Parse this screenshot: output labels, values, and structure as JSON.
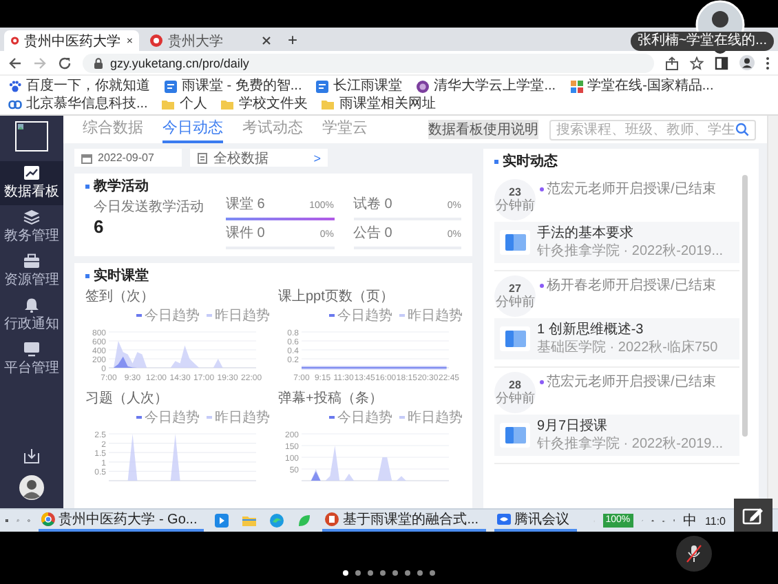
{
  "meeting": {
    "speaker_label": "张利楠~学堂在线的...",
    "pager": [
      {
        "selected": true
      },
      {
        "selected": false
      },
      {
        "selected": false
      },
      {
        "selected": false
      },
      {
        "selected": false
      },
      {
        "selected": false
      },
      {
        "selected": false
      },
      {
        "selected": false
      }
    ]
  },
  "browser": {
    "tabs": [
      {
        "title": "贵州中医药大学",
        "selected": true
      },
      {
        "title": "贵州大学",
        "selected": false
      }
    ],
    "new_tab": "+",
    "url": "gzy.yuketang.cn/pro/daily",
    "bookmarks": [
      {
        "label": "百度一下，你就知道",
        "kind": "paw"
      },
      {
        "label": "雨课堂 - 免费的智...",
        "kind": "site"
      },
      {
        "label": "长江雨课堂",
        "kind": "site"
      },
      {
        "label": "清华大学云上学堂...",
        "kind": "seal"
      },
      {
        "label": "学堂在线-国家精品...",
        "kind": "grid"
      },
      {
        "label": "北京慕华信息科技...",
        "kind": "link"
      },
      {
        "label": "个人",
        "kind": "folder"
      },
      {
        "label": "学校文件夹",
        "kind": "folder"
      },
      {
        "label": "雨课堂相关网址",
        "kind": "folder"
      }
    ]
  },
  "app": {
    "sidebar": {
      "items": [
        {
          "label": "数据看板",
          "kind": "chart",
          "selected": true
        },
        {
          "label": "教务管理",
          "kind": "layers",
          "selected": false
        },
        {
          "label": "资源管理",
          "kind": "box",
          "selected": false
        },
        {
          "label": "行政通知",
          "kind": "bell",
          "selected": false
        },
        {
          "label": "平台管理",
          "kind": "monitor",
          "selected": false
        }
      ]
    },
    "tabs": [
      {
        "label": "综合数据",
        "selected": false
      },
      {
        "label": "今日动态",
        "selected": true
      },
      {
        "label": "考试动态",
        "selected": false
      },
      {
        "label": "学堂云",
        "selected": false
      }
    ],
    "help_link": "数据看板使用说明",
    "search": {
      "placeholder": "搜索课程、班级、教师、学生"
    },
    "filters": {
      "date": "2022-09-07",
      "scope": "全校数据",
      "next": ">"
    },
    "teaching_activity": {
      "title": "教学活动",
      "summary_label": "今日发送教学活动",
      "summary_value": "6",
      "metrics": [
        {
          "label": "课堂",
          "count": "6",
          "percent": "100%",
          "level": 1
        },
        {
          "label": "试卷",
          "count": "0",
          "percent": "0%",
          "level": 0
        },
        {
          "label": "课件",
          "count": "0",
          "percent": "0%",
          "level": 0
        },
        {
          "label": "公告",
          "count": "0",
          "percent": "0%",
          "level": 0
        }
      ]
    },
    "live_class": {
      "title": "实时课堂",
      "charts": [
        {
          "title": "签到（次）",
          "chart_data": {
            "type": "area",
            "x": [
              7,
              7.5,
              8,
              8.5,
              9,
              9.5,
              10,
              10.5,
              11,
              11.5,
              12,
              12.5,
              13,
              13.5,
              14,
              14.5,
              15,
              15.5,
              16,
              16.5,
              17,
              17.5,
              18,
              18.5,
              19,
              19.5,
              20,
              20.5,
              21,
              21.5,
              22,
              22.5
            ],
            "xlim": [
              7,
              22.5
            ],
            "ylim": [
              0,
              800
            ],
            "yticks": [
              0,
              200,
              400,
              600,
              800
            ],
            "grid": true,
            "legend": "top-right",
            "xticks": [
              {
                "value": 7,
                "label": "7:00"
              },
              {
                "value": 9.5,
                "label": "9:30"
              },
              {
                "value": 12,
                "label": "12:00"
              },
              {
                "value": 14.5,
                "label": "14:30"
              },
              {
                "value": 17,
                "label": "17:00"
              },
              {
                "value": 19.5,
                "label": "19:30"
              },
              {
                "value": 22,
                "label": "22:00"
              }
            ],
            "series": [
              {
                "name": "今日趋势",
                "color": "#6a79ee",
                "values": [
                  0,
                  0,
                  80,
                  250,
                  30,
                  10,
                  0,
                  0,
                  0,
                  0,
                  0,
                  0,
                  0,
                  0,
                  0,
                  0,
                  0,
                  0,
                  0,
                  0,
                  0,
                  0,
                  0,
                  0,
                  0,
                  0,
                  0,
                  0,
                  0,
                  0,
                  0,
                  0
                ]
              },
              {
                "name": "昨日趋势",
                "color": "#c5cbf8",
                "values": [
                  0,
                  0,
                  600,
                  350,
                  300,
                  100,
                  350,
                  300,
                  0,
                  0,
                  0,
                  0,
                  0,
                  0,
                  150,
                  100,
                  500,
                  200,
                  100,
                  0,
                  0,
                  0,
                  0,
                  200,
                  0,
                  0,
                  0,
                  0,
                  0,
                  0,
                  0,
                  0
                ]
              }
            ]
          }
        },
        {
          "title": "课上ppt页数（页）",
          "chart_data": {
            "type": "line",
            "x": [
              7,
              7.5,
              8,
              8.5,
              9,
              9.5,
              10,
              10.5,
              11,
              11.5,
              12,
              12.5,
              13,
              13.5,
              14,
              14.5,
              15,
              15.5,
              16,
              16.5,
              17,
              17.5,
              18,
              18.5,
              19,
              19.5,
              20,
              20.5,
              21,
              21.5,
              22,
              22.5
            ],
            "xlim": [
              7,
              22.75
            ],
            "ylim": [
              0,
              0.8
            ],
            "yticks": [
              0.2,
              0.4,
              0.6,
              0.8
            ],
            "grid": true,
            "legend": "top-right",
            "xticks": [
              {
                "value": 7,
                "label": "7:00"
              },
              {
                "value": 9.25,
                "label": "9:15"
              },
              {
                "value": 11.5,
                "label": "11:30"
              },
              {
                "value": 13.75,
                "label": "13:45"
              },
              {
                "value": 16,
                "label": "16:00"
              },
              {
                "value": 18.25,
                "label": "18:15"
              },
              {
                "value": 20.5,
                "label": "20:30"
              },
              {
                "value": 22.75,
                "label": "22:45"
              }
            ],
            "series": [
              {
                "name": "今日趋势",
                "color": "#6a79ee",
                "values": [
                  0,
                  0,
                  0,
                  0,
                  0,
                  0,
                  0,
                  0,
                  0,
                  0,
                  0,
                  0,
                  0,
                  0,
                  0,
                  0,
                  0,
                  0,
                  0,
                  0,
                  0,
                  0,
                  0,
                  0,
                  0,
                  0,
                  0,
                  0,
                  0,
                  0,
                  0,
                  0
                ]
              },
              {
                "name": "昨日趋势",
                "color": "#c5cbf8",
                "values": [
                  0,
                  0,
                  0,
                  0,
                  0,
                  0,
                  0,
                  0,
                  0,
                  0,
                  0,
                  0,
                  0,
                  0,
                  0,
                  0,
                  0,
                  0,
                  0,
                  0,
                  0,
                  0,
                  0,
                  0,
                  0,
                  0,
                  0,
                  0,
                  0,
                  0,
                  0,
                  0
                ]
              }
            ]
          }
        },
        {
          "title": "习题（人次）",
          "chart_data": {
            "type": "area",
            "ylim": [
              0,
              2.5
            ],
            "yticks": [
              0.5,
              1,
              1.5,
              2,
              2.5
            ],
            "grid": true,
            "legend": "top-right",
            "series": [
              {
                "name": "今日趋势",
                "color": "#6a79ee",
                "values": [
                  null,
                  null,
                  null,
                  null,
                  null,
                  null,
                  null,
                  null,
                  null,
                  null,
                  null,
                  null,
                  null,
                  null,
                  null,
                  null,
                  null,
                  null,
                  null,
                  null,
                  null,
                  null,
                  null,
                  null,
                  null,
                  null,
                  null,
                  null,
                  null,
                  null,
                  null,
                  null
                ]
              },
              {
                "name": "昨日趋势",
                "color": "#c5cbf8",
                "values": [
                  0,
                  0,
                  0,
                  0,
                  0,
                  2.5,
                  0,
                  0,
                  0,
                  0,
                  0,
                  0,
                  0,
                  0,
                  2.5,
                  0,
                  0,
                  0,
                  0,
                  0,
                  0,
                  0,
                  0,
                  0,
                  0,
                  0,
                  0,
                  0,
                  0,
                  0,
                  0,
                  0
                ]
              }
            ]
          }
        },
        {
          "title": "弹幕+投稿（条）",
          "chart_data": {
            "type": "area",
            "ylim": [
              0,
              200
            ],
            "yticks": [
              50,
              100,
              150,
              200
            ],
            "grid": true,
            "legend": "top-right",
            "series": [
              {
                "name": "今日趋势",
                "color": "#6a79ee",
                "values": [
                  0,
                  0,
                  0,
                  40,
                  0,
                  0,
                  0,
                  0,
                  0,
                  0,
                  0,
                  0,
                  0,
                  0,
                  0,
                  0,
                  0,
                  0,
                  0,
                  0,
                  0,
                  0,
                  0,
                  0,
                  0,
                  0,
                  0,
                  0,
                  0,
                  0,
                  0,
                  0
                ]
              },
              {
                "name": "昨日趋势",
                "color": "#c5cbf8",
                "values": [
                  0,
                  0,
                  0,
                  50,
                  0,
                  0,
                  20,
                  150,
                  0,
                  0,
                  30,
                  0,
                  0,
                  0,
                  0,
                  0,
                  0,
                  100,
                  100,
                  0,
                  0,
                  20,
                  0,
                  0,
                  0,
                  0,
                  0,
                  0,
                  0,
                  0,
                  0,
                  0
                ]
              }
            ]
          }
        }
      ]
    },
    "live_feed": {
      "title": "实时动态",
      "items": [
        {
          "time": "23",
          "unit": "分钟前",
          "event": "范宏元老师开启授课/已结束",
          "course": "手法的基本要求",
          "detail": "针灸推拿学院 · 2022秋-2019..."
        },
        {
          "time": "27",
          "unit": "分钟前",
          "event": "杨开春老师开启授课/已结束",
          "course": "1 创新思维概述-3",
          "detail": "基础医学院 · 2022秋-临床750"
        },
        {
          "time": "28",
          "unit": "分钟前",
          "event": "范宏元老师开启授课/已结束",
          "course": "9月7日授课",
          "detail": "针灸推拿学院 · 2022秋-2019..."
        }
      ]
    }
  },
  "taskbar": {
    "apps": [
      {
        "kind": "chrome",
        "label": "贵州中医药大学 - Go..."
      },
      {
        "kind": "tile"
      },
      {
        "kind": "folder"
      },
      {
        "kind": "edge"
      },
      {
        "kind": "leaf"
      },
      {
        "kind": "ppt",
        "label": "基于雨课堂的融合式..."
      },
      {
        "kind": "meeting",
        "label": "腾讯会议"
      }
    ],
    "battery": "100%",
    "ime": "中",
    "clock": "11:0"
  }
}
